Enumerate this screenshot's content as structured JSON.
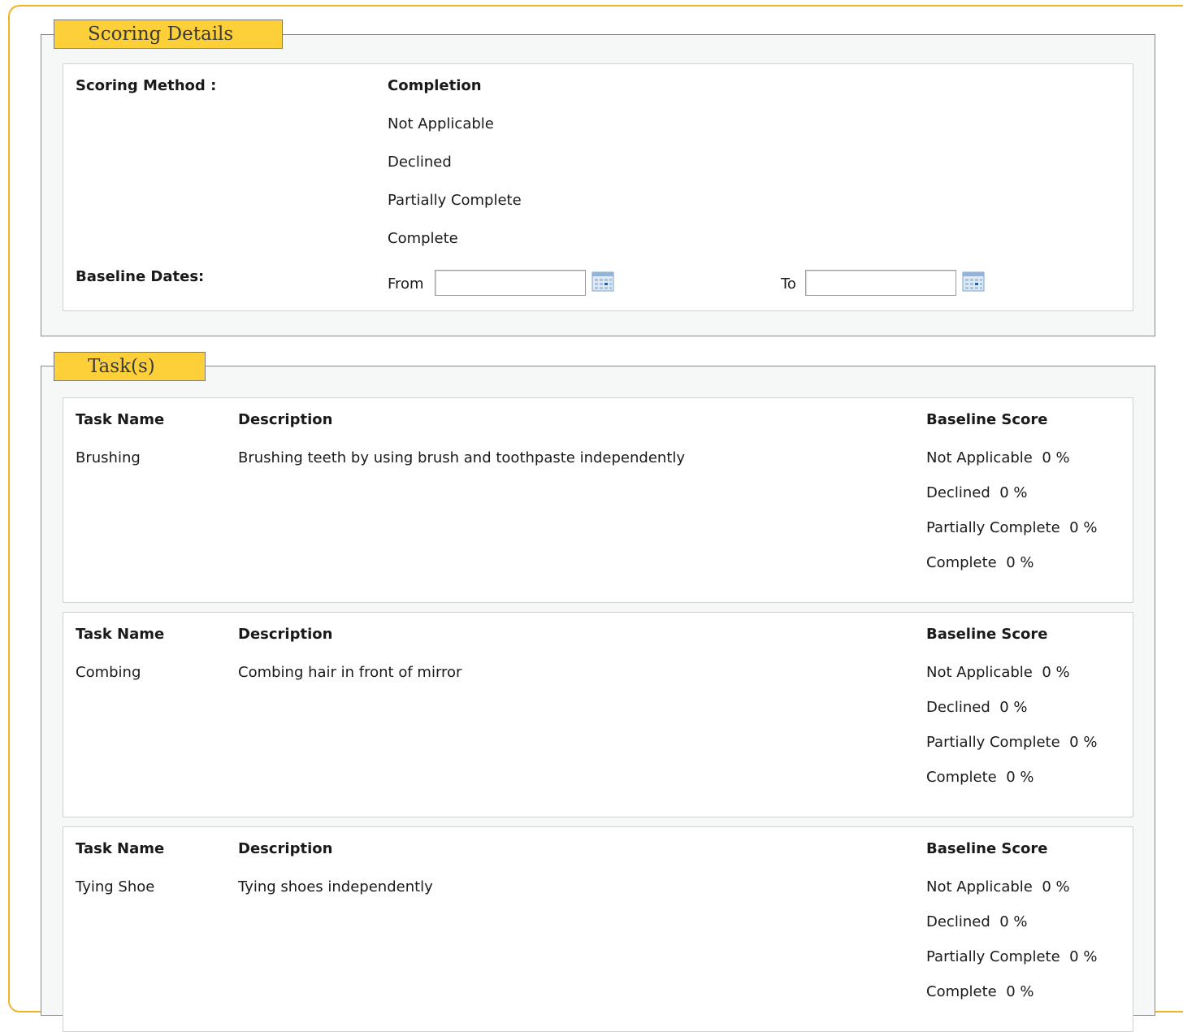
{
  "scoring": {
    "legend": "Scoring Details",
    "method_label": "Scoring Method :",
    "method_value": "Completion",
    "options": [
      "Not Applicable",
      "Declined",
      "Partially Complete",
      "Complete"
    ],
    "baseline_label": "Baseline Dates:",
    "from_label": "From",
    "to_label": "To",
    "from_value": "",
    "to_value": ""
  },
  "tasks": {
    "legend": "Task(s)",
    "headers": {
      "name": "Task Name",
      "description": "Description",
      "score": "Baseline Score"
    },
    "items": [
      {
        "name": "Brushing",
        "description": "Brushing teeth by using brush and toothpaste independently",
        "scores": [
          {
            "label": "Not Applicable",
            "value": "0 %"
          },
          {
            "label": "Declined",
            "value": "0 %"
          },
          {
            "label": "Partially Complete",
            "value": "0 %"
          },
          {
            "label": "Complete",
            "value": "0 %"
          }
        ]
      },
      {
        "name": "Combing",
        "description": "Combing hair in front of mirror",
        "scores": [
          {
            "label": "Not Applicable",
            "value": "0 %"
          },
          {
            "label": "Declined",
            "value": "0 %"
          },
          {
            "label": "Partially Complete",
            "value": "0 %"
          },
          {
            "label": "Complete",
            "value": "0 %"
          }
        ]
      },
      {
        "name": "Tying Shoe",
        "description": "Tying shoes independently",
        "scores": [
          {
            "label": "Not Applicable",
            "value": "0 %"
          },
          {
            "label": "Declined",
            "value": "0 %"
          },
          {
            "label": "Partially Complete",
            "value": "0 %"
          },
          {
            "label": "Complete",
            "value": "0 %"
          }
        ]
      }
    ]
  },
  "colors": {
    "frame": "#f0b323",
    "legend_bg": "#fdd03a",
    "section_bg": "#f6f7f7"
  },
  "icons": [
    "calendar-icon"
  ]
}
